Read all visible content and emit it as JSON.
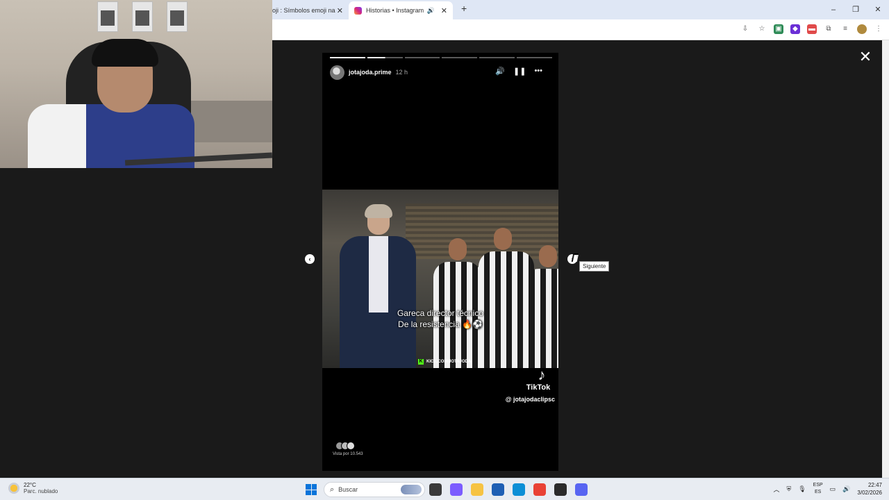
{
  "browser": {
    "tabs": [
      {
        "label": "oji : Símbolos emoji na",
        "active": false
      },
      {
        "label": "Historias • Instagram",
        "active": true
      }
    ],
    "new_tab_icon": "+",
    "window_controls": {
      "minimize": "–",
      "restore": "❐",
      "close": "✕"
    }
  },
  "story": {
    "username": "jotajoda.prime",
    "time_ago": "12 h",
    "segments_total": 6,
    "segments_done": 1,
    "current_progress": 0.5,
    "caption_line1": "Gareca director técnico",
    "caption_line2": "De la resistencia 🔥⚽",
    "watermark": "KICK.COM/JOTAJODA",
    "tiktok_logo": "♪",
    "tiktok_name": "TikTok",
    "tiktok_handle": "@ jotajodaclipsc",
    "viewers_text": "Vista por 10.543",
    "close_icon": "✕",
    "prev_icon": "‹",
    "next_icon": "›",
    "next_tooltip": "Siguiente",
    "controls": {
      "sound": "🔊",
      "pause": "❚❚",
      "more": "•••"
    }
  },
  "taskbar": {
    "temperature": "22°C",
    "weather_desc": "Parc. nublado",
    "search_placeholder": "Buscar",
    "lang_line1": "ESP",
    "lang_line2": "ES",
    "time": "22:47",
    "date": "3/02/2026",
    "app_colors": [
      "#3a3a3a",
      "#7b5cff",
      "#f6c343",
      "#1e5fb4",
      "#0c8fd6",
      "#e94235",
      "#2b2b2b",
      "#5865f2"
    ]
  }
}
